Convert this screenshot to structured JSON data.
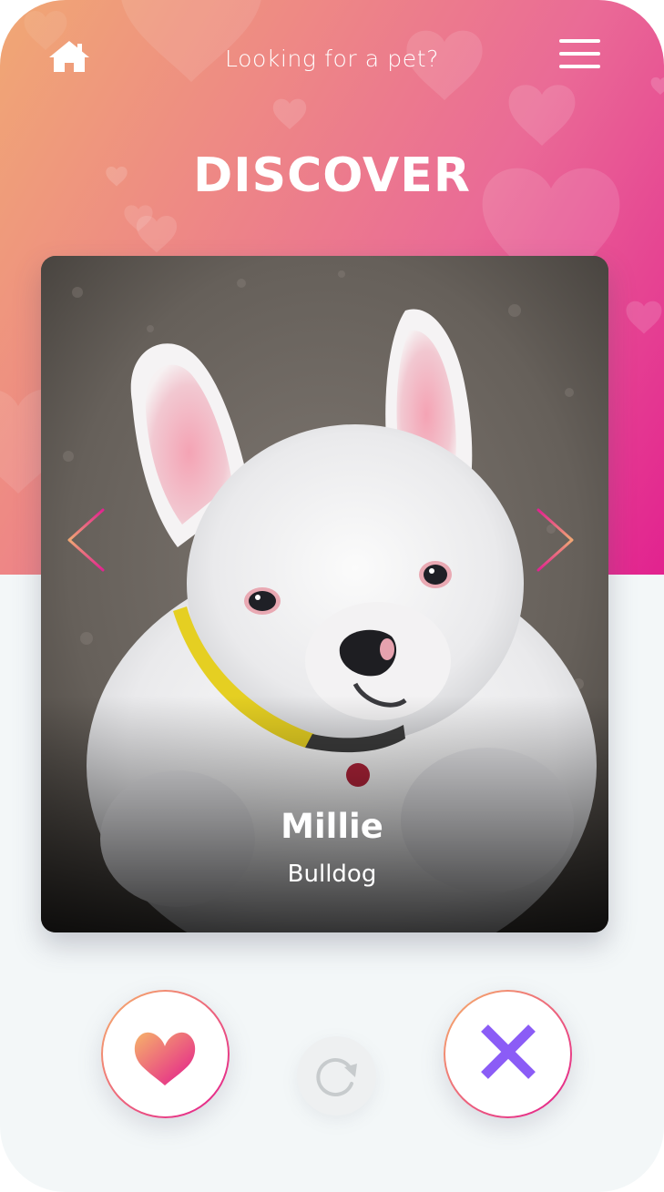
{
  "header": {
    "title": "Looking for a pet?",
    "home_icon": "home-icon",
    "menu_icon": "hamburger-menu-icon"
  },
  "page": {
    "title": "DISCOVER"
  },
  "card": {
    "pet_name": "Millie",
    "pet_breed": "Bulldog",
    "photo_icon": "white-french-bulldog-photo",
    "prev_icon": "chevron-left-icon",
    "next_icon": "chevron-right-icon"
  },
  "actions": {
    "like_icon": "heart-icon",
    "reload_icon": "reload-icon",
    "dislike_icon": "close-x-icon"
  },
  "colors": {
    "gradient_start": "#f0a874",
    "gradient_end": "#e2228f",
    "dislike_accent": "#8b5cf6",
    "background": "#f3f7f8"
  }
}
